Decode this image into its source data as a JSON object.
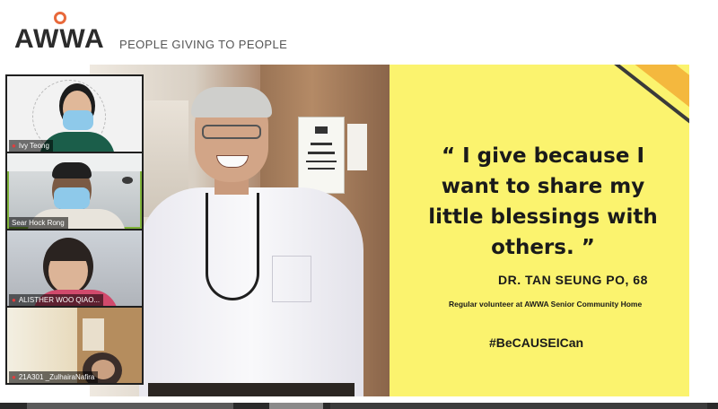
{
  "header": {
    "logo": "AWWA",
    "tagline": "PEOPLE GIVING TO PEOPLE"
  },
  "slide": {
    "quote": "“ I give because I want to share my little blessings with others. ”",
    "author": "DR. TAN SEUNG PO, 68",
    "role": "Regular volunteer at AWWA Senior Community Home",
    "hashtag": "#BeCAUSEICan"
  },
  "participants": [
    {
      "name": "Ivy Teong"
    },
    {
      "name": "Sear Hock Rong"
    },
    {
      "name": "ALISTHER WOO QIAO..."
    },
    {
      "name": "21A301 _ZulhairaNafira"
    }
  ],
  "colors": {
    "brand_orange": "#e8693b",
    "slide_yellow": "#fbf36e",
    "accent_orange": "#f4b83e",
    "active_speaker": "#7fb23a",
    "muted_mic": "#e23d3d"
  },
  "icons": [
    "muted-mic-icon"
  ]
}
